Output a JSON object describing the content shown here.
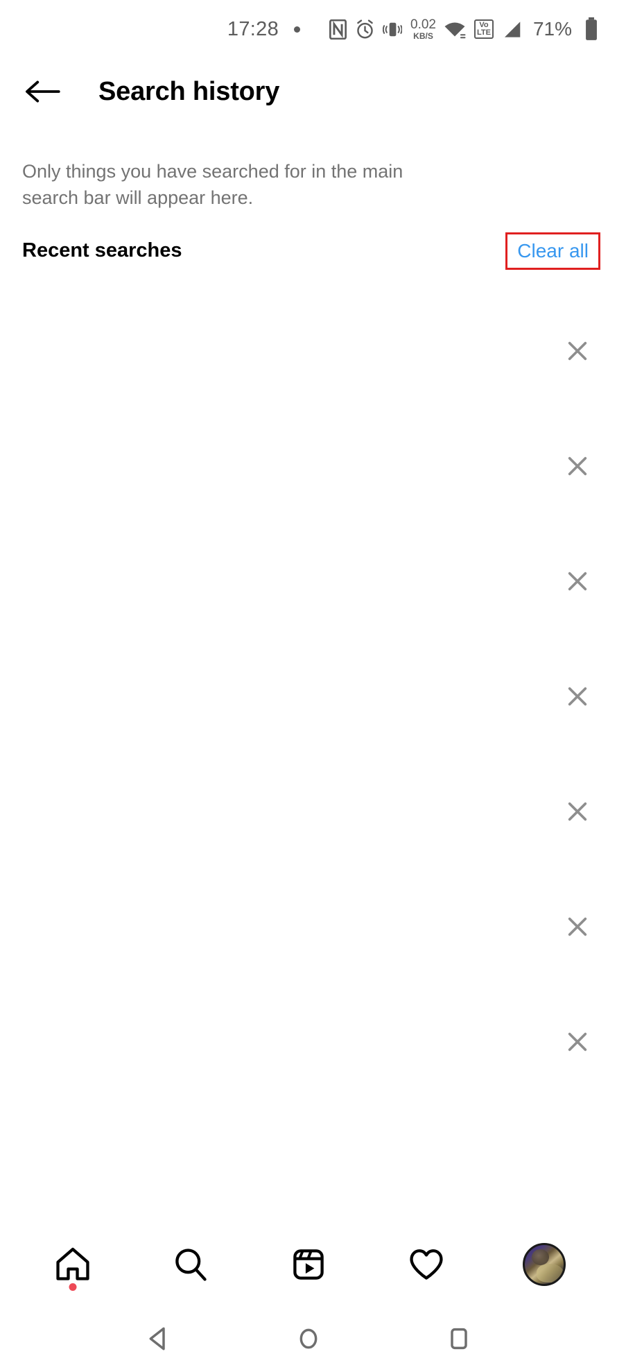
{
  "status_bar": {
    "time": "17:28",
    "separator_dot": "•",
    "icons": [
      "nfc-icon",
      "alarm-icon",
      "vibrate-icon",
      "wifi-icon",
      "volte-icon",
      "signal-icon"
    ],
    "net_speed_value": "0.02",
    "net_speed_unit": "KB/S",
    "volte_line1": "Vo",
    "volte_line2": "LTE",
    "battery_percent": "71%",
    "text_color": "#5c5c5c"
  },
  "app_bar": {
    "back_icon": "arrow-left-icon",
    "title": "Search history"
  },
  "description": "Only things you have searched for in the main search bar will appear here.",
  "recent": {
    "heading": "Recent searches",
    "clear_all_label": "Clear all",
    "clear_all_color": "#3797ef",
    "highlight_border_color": "#e02020"
  },
  "search_items": [
    {
      "remove_icon": "close-icon"
    },
    {
      "remove_icon": "close-icon"
    },
    {
      "remove_icon": "close-icon"
    },
    {
      "remove_icon": "close-icon"
    },
    {
      "remove_icon": "close-icon"
    },
    {
      "remove_icon": "close-icon"
    },
    {
      "remove_icon": "close-icon"
    }
  ],
  "tab_bar": {
    "tabs": [
      {
        "name": "home-tab",
        "icon": "home-icon",
        "badge": true,
        "badge_color": "#ed4956"
      },
      {
        "name": "search-tab",
        "icon": "search-icon",
        "badge": false
      },
      {
        "name": "reels-tab",
        "icon": "reels-icon",
        "badge": false
      },
      {
        "name": "activity-tab",
        "icon": "heart-icon",
        "badge": false
      },
      {
        "name": "profile-tab",
        "icon": "avatar-icon",
        "badge": false
      }
    ]
  },
  "system_nav": {
    "buttons": [
      {
        "name": "android-back-button",
        "icon": "triangle-left-icon"
      },
      {
        "name": "android-home-button",
        "icon": "circle-icon"
      },
      {
        "name": "android-recents-button",
        "icon": "square-icon"
      }
    ],
    "icon_color": "#6e6e6e"
  }
}
